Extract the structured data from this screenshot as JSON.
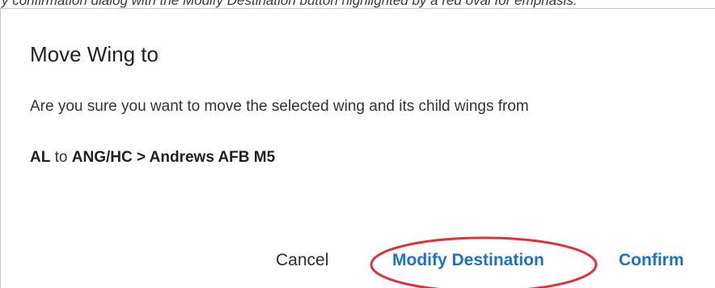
{
  "page_caption_fragment": "y confirmation dialog with the Modify Destination button highlighted by a red oval for emphasis.",
  "dialog": {
    "title": "Move Wing to",
    "message": "Are you sure you want to move the selected wing and its child wings from",
    "path": {
      "source": "AL",
      "connector": "to",
      "destination": "ANG/HC > Andrews AFB M5"
    },
    "actions": {
      "cancel_label": "Cancel",
      "modify_label": "Modify Destination",
      "confirm_label": "Confirm"
    }
  },
  "colors": {
    "accent": "#1a73c8",
    "highlight": "#e0303a",
    "text": "#212121"
  }
}
